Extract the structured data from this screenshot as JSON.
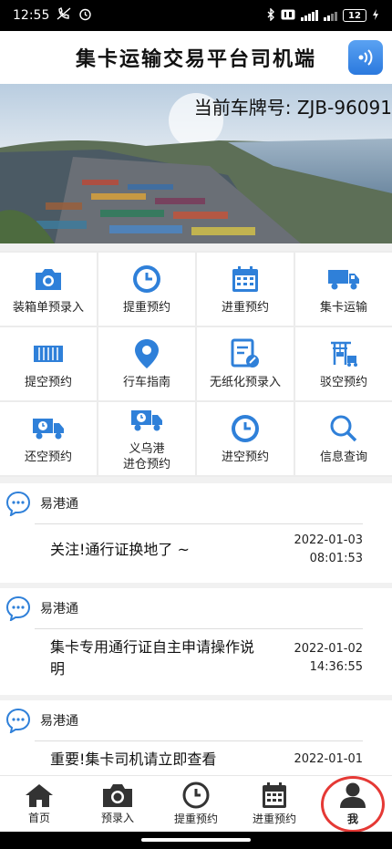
{
  "status_bar": {
    "time": "12:55",
    "battery": "12"
  },
  "header": {
    "title": "集卡运输交易平台司机端"
  },
  "banner": {
    "plate_label": "当前车牌号: ZJB-96091"
  },
  "menu": [
    {
      "label": "装箱单预录入",
      "icon": "camera-icon"
    },
    {
      "label": "提重预约",
      "icon": "clock-icon"
    },
    {
      "label": "进重预约",
      "icon": "calendar-icon"
    },
    {
      "label": "集卡运输",
      "icon": "truck-icon"
    },
    {
      "label": "提空预约",
      "icon": "container-icon"
    },
    {
      "label": "行车指南",
      "icon": "location-pin-icon"
    },
    {
      "label": "无纸化预录入",
      "icon": "document-edit-icon"
    },
    {
      "label": "驳空预约",
      "icon": "crane-icon"
    },
    {
      "label": "还空预约",
      "icon": "truck-clock-icon"
    },
    {
      "label": "义乌港\n进仓预约",
      "icon": "truck-clock-icon"
    },
    {
      "label": "进空预约",
      "icon": "clock-icon"
    },
    {
      "label": "信息查询",
      "icon": "search-icon"
    }
  ],
  "news": [
    {
      "source": "易港通",
      "headline": "关注!通行证换地了 ~",
      "date": "2022-01-03",
      "time": "08:01:53"
    },
    {
      "source": "易港通",
      "headline": "集卡专用通行证自主申请操作说明",
      "date": "2022-01-02",
      "time": "14:36:55"
    },
    {
      "source": "易港通",
      "headline": "重要!集卡司机请立即查看",
      "date": "2022-01-01",
      "time": ""
    }
  ],
  "tabs": [
    {
      "label": "首页",
      "icon": "home-icon"
    },
    {
      "label": "预录入",
      "icon": "camera-icon"
    },
    {
      "label": "提重预约",
      "icon": "clock-icon"
    },
    {
      "label": "进重预约",
      "icon": "calendar-icon"
    },
    {
      "label": "我",
      "icon": "user-icon"
    }
  ],
  "colors": {
    "accent": "#2f80d9",
    "dark_icon": "#333333",
    "highlight_ring": "#e53935"
  }
}
